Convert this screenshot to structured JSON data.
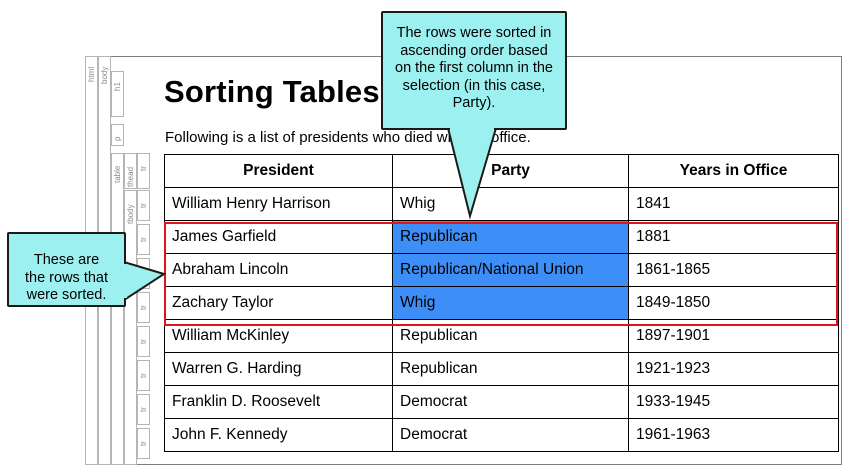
{
  "tag_bar": {
    "html": "html",
    "body": "body",
    "h1": "h1",
    "p": "p",
    "table": "table",
    "thead": "thead",
    "tbody": "tbody",
    "tr": "tr"
  },
  "heading": "Sorting Tables",
  "paragraph": "Following is a list of presidents who died while in office.",
  "table": {
    "headers": [
      "President",
      "Party",
      "Years in Office"
    ],
    "rows": [
      [
        "William Henry Harrison",
        "Whig",
        "1841"
      ],
      [
        "James Garfield",
        "Republican",
        "1881"
      ],
      [
        "Abraham Lincoln",
        "Republican/National Union",
        "1861-1865"
      ],
      [
        "Zachary Taylor",
        "Whig",
        "1849-1850"
      ],
      [
        "William McKinley",
        "Republican",
        "1897-1901"
      ],
      [
        "Warren G. Harding",
        "Republican",
        "1921-1923"
      ],
      [
        "Franklin D. Roosevelt",
        "Democrat",
        "1933-1945"
      ],
      [
        "John F. Kennedy",
        "Democrat",
        "1961-1963"
      ]
    ]
  },
  "callouts": {
    "top": "The rows were sorted in ascending order based on the first column in the selection (in this case, Party).",
    "left": "These are the rows that were sorted."
  },
  "colors": {
    "highlight": "#3d8ef7",
    "selection_border": "#e0141e",
    "callout_fill": "#9cf0f0"
  }
}
